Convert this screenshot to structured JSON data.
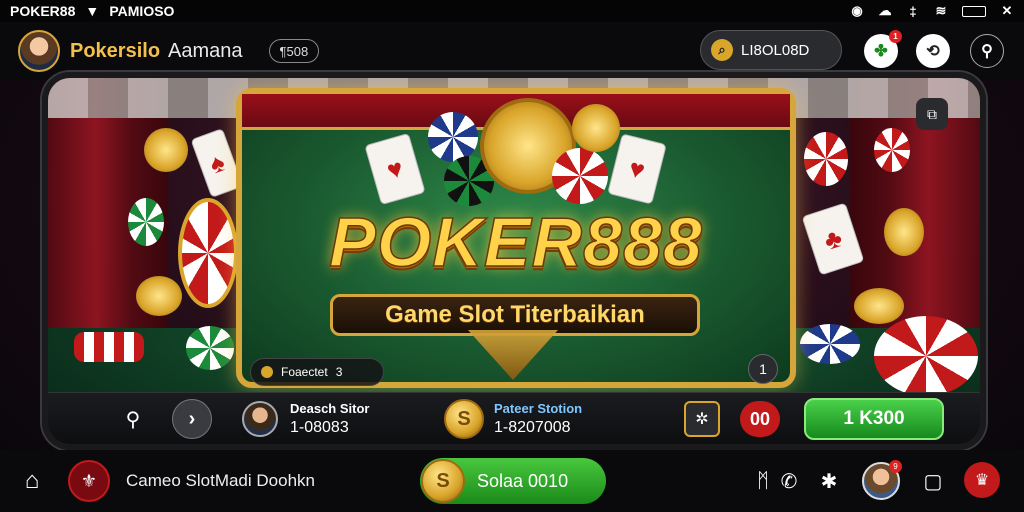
{
  "status_bar": {
    "app_label": "POKER88",
    "secondary_label": "PAMIOSO",
    "icons": [
      "badge-icon",
      "clock-icon",
      "signal-icon",
      "bars-icon",
      "wifi-icon",
      "battery-icon",
      "close-icon"
    ]
  },
  "app_bar": {
    "name": "Pokersilo",
    "subtitle": "Aamana",
    "chip_label": "¶508",
    "search_value": "LI8OL08D",
    "icons": [
      "profile-avatar",
      "search-icon",
      "clover-icon",
      "switch-icon",
      "settings-icon"
    ],
    "notification_badge": "1"
  },
  "banner": {
    "logo": "POKER888",
    "tagline": "Game Slot Titerbaikian",
    "notice_label": "Foaectet",
    "notice_count": "3",
    "page_number": "1",
    "bookmark_icon": "bookmark-icon"
  },
  "player_strip": {
    "player_label": "Deasch Sitor",
    "player_value": "1-08083",
    "pot_label": "Pateer Stotion",
    "pot_value": "1-8207008",
    "red_button": "00",
    "green_button": "1 K300"
  },
  "bottom_bar": {
    "title": "Cameo SlotMadi Doohkn",
    "play_label": "Solaa 0010",
    "avatar_badge": "9",
    "icons": [
      "home-icon",
      "brand-icon",
      "grid-icon",
      "phone-icon",
      "settings-icon",
      "user-avatar",
      "chat-icon",
      "favorite-icon"
    ]
  },
  "colors": {
    "gold": "#d6a63a",
    "green": "#1b8a1a",
    "red": "#c21a1a",
    "felt": "#1a5a30"
  }
}
